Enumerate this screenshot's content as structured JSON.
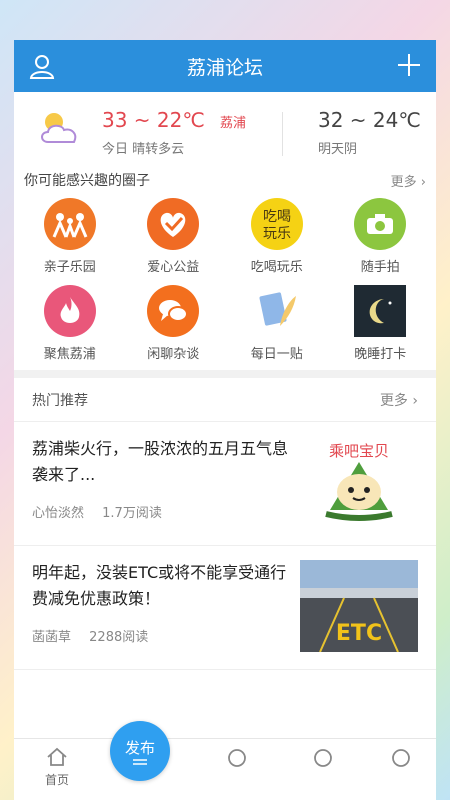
{
  "header": {
    "title": "荔浦论坛"
  },
  "weather": {
    "today_temp": "33 ~ 22℃",
    "today_city": "荔浦",
    "today_desc": "今日 晴转多云",
    "tomorrow_temp": "32 ~ 24℃",
    "tomorrow_desc": "明天阴"
  },
  "circles": {
    "label": "你可能感兴趣的圈子",
    "more": "更多",
    "items": [
      {
        "name": "亲子乐园",
        "color": "#f07828"
      },
      {
        "name": "爱心公益",
        "color": "#f06b24"
      },
      {
        "name": "吃喝玩乐",
        "color": "#f5d214",
        "badge": "吃喝玩乐"
      },
      {
        "name": "随手拍",
        "color": "#8cc63f"
      },
      {
        "name": "聚焦荔浦",
        "color": "#e9577a"
      },
      {
        "name": "闲聊杂谈",
        "color": "#f36f1e"
      },
      {
        "name": "每日一贴",
        "color": "#8fb7e8"
      },
      {
        "name": "晚睡打卡",
        "color": "#1f2a33"
      }
    ]
  },
  "hot": {
    "label": "热门推荐",
    "more": "更多",
    "posts": [
      {
        "title": "荔浦柴火行，一股浓浓的五月五气息袭来了...",
        "author": "心怡淡然",
        "reads": "1.7万阅读",
        "thumb_text": "乘吧宝贝"
      },
      {
        "title": "明年起，没装ETC或将不能享受通行费减免优惠政策！",
        "author": "菡菡草",
        "reads": "2288阅读",
        "thumb_text": "ETC"
      }
    ]
  },
  "tabbar": {
    "home": "首页",
    "publish": "发布"
  },
  "colors": {
    "brand": "#2b8fdc",
    "accent_red": "#e2474f"
  }
}
